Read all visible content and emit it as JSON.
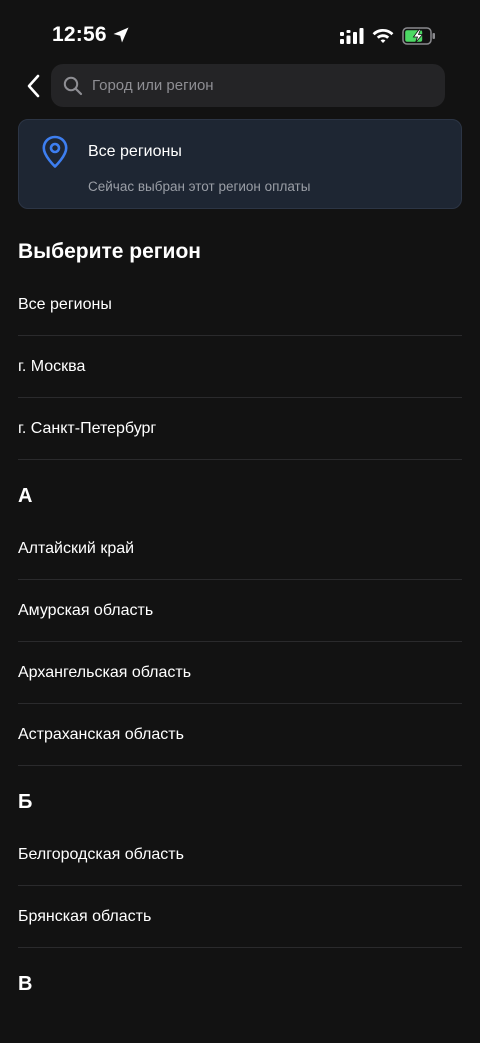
{
  "status_bar": {
    "time": "12:56",
    "icons": [
      "location-arrow-icon",
      "signal-icon",
      "wifi-icon",
      "battery-charging-icon"
    ]
  },
  "search": {
    "placeholder": "Город или регион",
    "value": ""
  },
  "current_region": {
    "title": "Все регионы",
    "subtitle": "Сейчас выбран этот регион оплаты"
  },
  "heading": "Выберите регион",
  "top_items": [
    "Все регионы",
    "г. Москва",
    "г. Санкт-Петербург"
  ],
  "groups": [
    {
      "letter": "А",
      "items": [
        "Алтайский край",
        "Амурская область",
        "Архангельская область",
        "Астраханская область"
      ]
    },
    {
      "letter": "Б",
      "items": [
        "Белгородская область",
        "Брянская область"
      ]
    },
    {
      "letter": "В",
      "items": []
    }
  ],
  "colors": {
    "background": "#121212",
    "accent": "#3d7ef0",
    "card": "#1e2633",
    "battery": "#4cd964"
  }
}
